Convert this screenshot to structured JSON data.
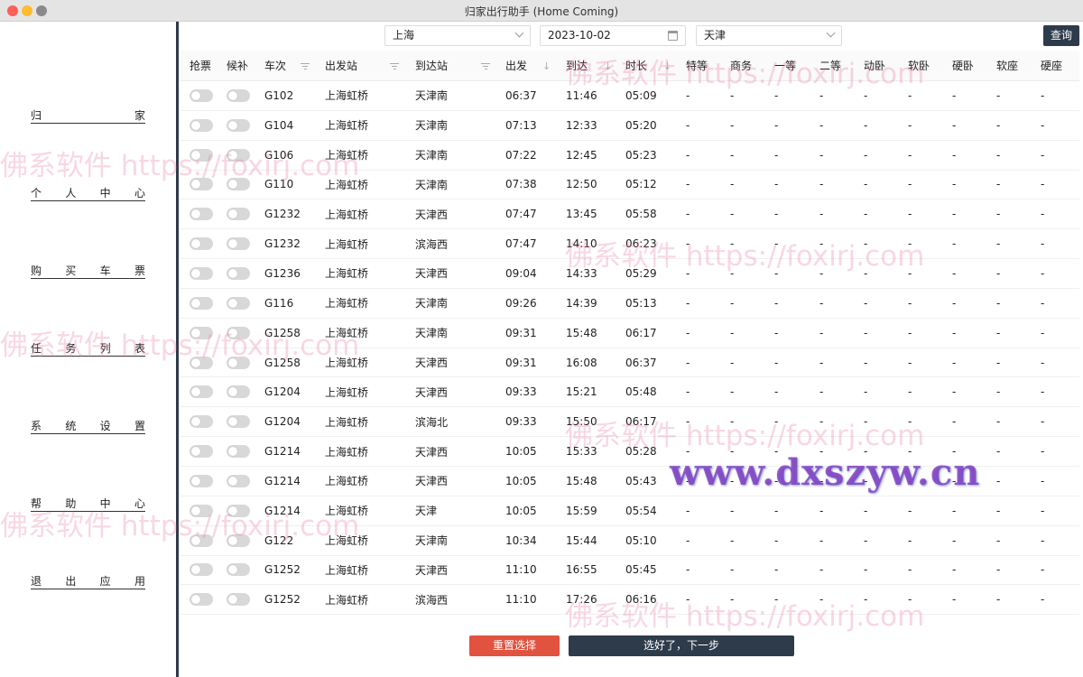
{
  "window": {
    "title": "归家出行助手 (Home Coming)"
  },
  "sidebar": {
    "items": [
      {
        "label": "归家",
        "chars": [
          "归",
          "家"
        ]
      },
      {
        "label": "个人中心",
        "chars": [
          "个",
          "人",
          "中",
          "心"
        ]
      },
      {
        "label": "购买车票",
        "chars": [
          "购",
          "买",
          "车",
          "票"
        ]
      },
      {
        "label": "任务列表",
        "chars": [
          "任",
          "务",
          "列",
          "表"
        ]
      },
      {
        "label": "系统设置",
        "chars": [
          "系",
          "统",
          "设",
          "置"
        ]
      },
      {
        "label": "帮助中心",
        "chars": [
          "帮",
          "助",
          "中",
          "心"
        ]
      },
      {
        "label": "退出应用",
        "chars": [
          "退",
          "出",
          "应",
          "用"
        ]
      }
    ]
  },
  "toolbar": {
    "from_station": "上海",
    "date": "2023-10-02",
    "to_station": "天津",
    "query_label": "查询"
  },
  "table": {
    "columns": [
      "抢票",
      "候补",
      "车次",
      "出发站",
      "到达站",
      "出发",
      "到达",
      "时长",
      "特等",
      "商务",
      "一等",
      "二等",
      "动卧",
      "软卧",
      "硬卧",
      "软座",
      "硬座"
    ],
    "rows": [
      [
        "G102",
        "上海虹桥",
        "天津南",
        "06:37",
        "11:46",
        "05:09"
      ],
      [
        "G104",
        "上海虹桥",
        "天津南",
        "07:13",
        "12:33",
        "05:20"
      ],
      [
        "G106",
        "上海虹桥",
        "天津南",
        "07:22",
        "12:45",
        "05:23"
      ],
      [
        "G110",
        "上海虹桥",
        "天津南",
        "07:38",
        "12:50",
        "05:12"
      ],
      [
        "G1232",
        "上海虹桥",
        "天津西",
        "07:47",
        "13:45",
        "05:58"
      ],
      [
        "G1232",
        "上海虹桥",
        "滨海西",
        "07:47",
        "14:10",
        "06:23"
      ],
      [
        "G1236",
        "上海虹桥",
        "天津西",
        "09:04",
        "14:33",
        "05:29"
      ],
      [
        "G116",
        "上海虹桥",
        "天津南",
        "09:26",
        "14:39",
        "05:13"
      ],
      [
        "G1258",
        "上海虹桥",
        "天津南",
        "09:31",
        "15:48",
        "06:17"
      ],
      [
        "G1258",
        "上海虹桥",
        "天津西",
        "09:31",
        "16:08",
        "06:37"
      ],
      [
        "G1204",
        "上海虹桥",
        "天津西",
        "09:33",
        "15:21",
        "05:48"
      ],
      [
        "G1204",
        "上海虹桥",
        "滨海北",
        "09:33",
        "15:50",
        "06:17"
      ],
      [
        "G1214",
        "上海虹桥",
        "天津西",
        "10:05",
        "15:33",
        "05:28"
      ],
      [
        "G1214",
        "上海虹桥",
        "天津西",
        "10:05",
        "15:48",
        "05:43"
      ],
      [
        "G1214",
        "上海虹桥",
        "天津",
        "10:05",
        "15:59",
        "05:54"
      ],
      [
        "G122",
        "上海虹桥",
        "天津南",
        "10:34",
        "15:44",
        "05:10"
      ],
      [
        "G1252",
        "上海虹桥",
        "天津西",
        "11:10",
        "16:55",
        "05:45"
      ],
      [
        "G1252",
        "上海虹桥",
        "滨海西",
        "11:10",
        "17:26",
        "06:16"
      ]
    ],
    "seat_placeholder": "-"
  },
  "actions": {
    "reset_label": "重置选择",
    "next_label": "选好了，下一步"
  },
  "watermarks": {
    "foxirj": "佛系软件 https://foxirj.com",
    "dxszyw": "www.dxszyw.cn"
  },
  "colors": {
    "accent_dark": "#2e3b4a",
    "danger": "#e2533f",
    "toggle_off": "#d8d8d8"
  }
}
